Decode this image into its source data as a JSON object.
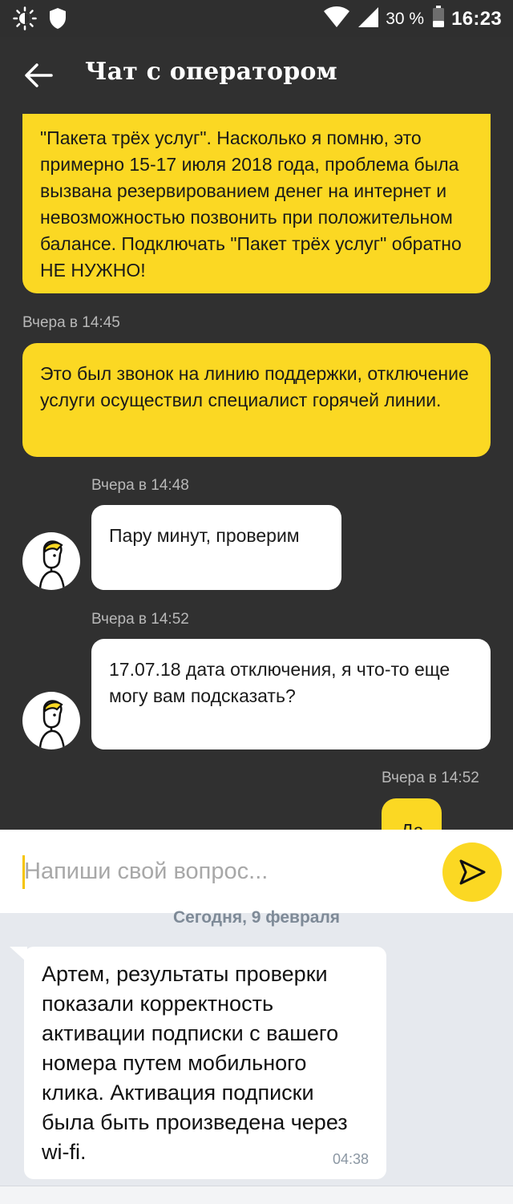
{
  "status_bar": {
    "battery_percent": "30 %",
    "time": "16:23",
    "icons": [
      "brightness-icon",
      "shield-icon",
      "wifi-icon",
      "signal-icon",
      "battery-icon"
    ]
  },
  "header": {
    "title": "Чат с оператором"
  },
  "messages": [
    {
      "sender": "user",
      "text": "\"Пакета трёх услуг\". Насколько я помню, это примерно 15-17 июля 2018 года, проблема была вызвана резервированием денег на интернет и невозможностью позвонить при положительном балансе. Подключать \"Пакет трёх услуг\" обратно НЕ НУЖНО!"
    },
    {
      "sender": "user",
      "time": "Вчера в 14:45",
      "text": "Это был звонок на линию поддержки, отключение услуги осуществил специалист горячей линии."
    },
    {
      "sender": "operator",
      "time": "Вчера в 14:48",
      "text": "Пару минут, проверим"
    },
    {
      "sender": "operator",
      "time": "Вчера в 14:52",
      "text": "17.07.18 дата отключения, я что-то еще могу вам подсказать?"
    },
    {
      "sender": "user",
      "time": "Вчера в 14:52",
      "text": "Да"
    }
  ],
  "input": {
    "placeholder": "Напиши свой вопрос..."
  },
  "overlay": {
    "date_label": "Сегодня, 9 февраля",
    "message": "Артем, результаты проверки показали корректность активации подписки с вашего номера путем мобильного клика. Активация подписки была быть произведена через wi-fi.",
    "time": "04:38"
  },
  "colors": {
    "background": "#303030",
    "accent_yellow": "#fbd823",
    "operator_bubble": "#ffffff",
    "overlay_background": "#e6e9ee"
  }
}
